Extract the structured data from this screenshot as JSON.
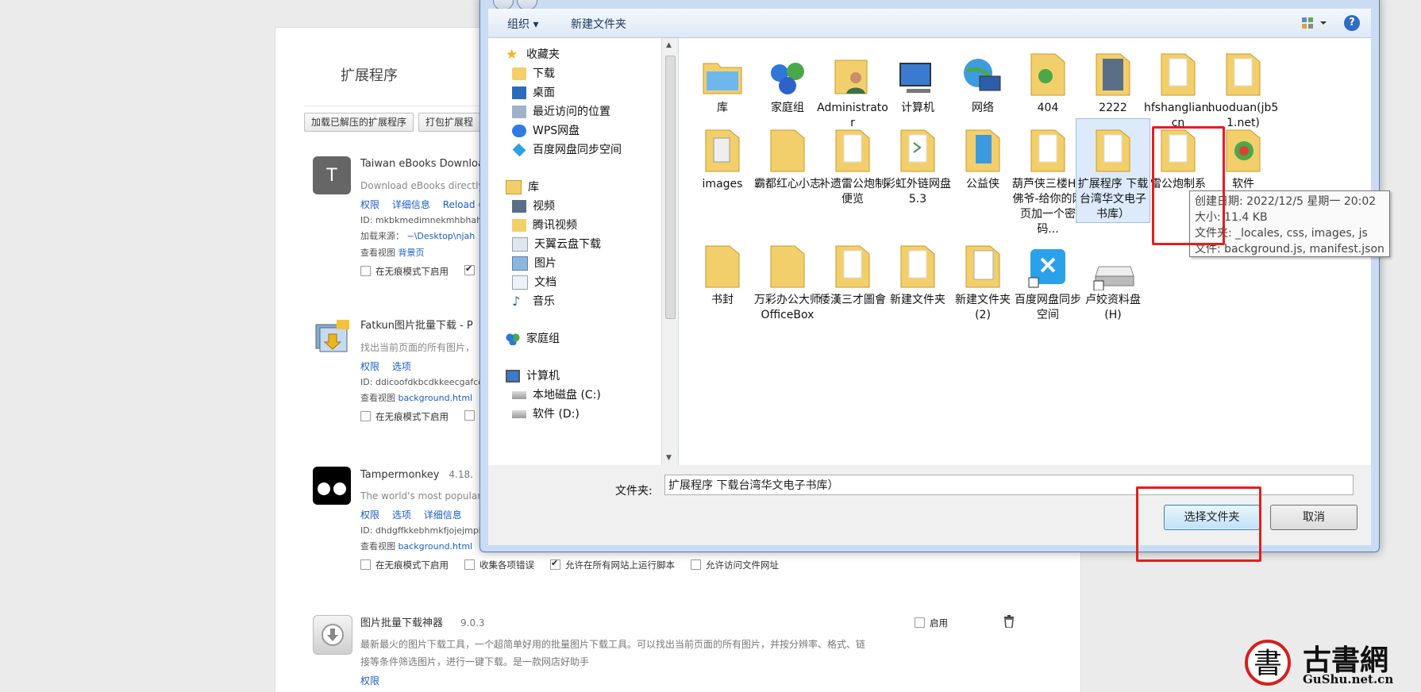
{
  "ext_page": {
    "title": "扩展程序",
    "load_unpacked": "加载已解压的扩展程序",
    "pack": "打包扩展程",
    "extensions": [
      {
        "icon_letter": "T",
        "name": "Taiwan eBooks Downloa",
        "desc": "Download eBooks directly",
        "links": [
          "权限",
          "详细信息",
          "Reload (C"
        ],
        "id": "ID: mkbkmedimnekmhbhahk",
        "source_label": "加载来源：",
        "source_path": "~\\Desktop\\njah",
        "view_label": "查看视图",
        "view_link": "背景页",
        "checks": [
          "在无痕模式下启用"
        ]
      },
      {
        "name": "Fatkun图片批量下载 - P",
        "desc": "找出当前页面的所有图片，",
        "links": [
          "权限",
          "选项"
        ],
        "id": "ID: ddicoofdkbcdkkeecgafco",
        "view_label": "查看视图",
        "view_link": "background.html",
        "checks": [
          "在无痕模式下启用"
        ]
      },
      {
        "name": "Tampermonkey",
        "version": "4.18.",
        "desc": "The world's most popular",
        "links": [
          "权限",
          "选项",
          "详细信息"
        ],
        "id": "ID: dhdgffkkebhmkfjojejmpb",
        "view_label": "查看视图",
        "view_link": "background.html",
        "checks": [
          "在无痕模式下启用",
          "收集各项错误",
          "允许在所有网站上运行脚本",
          "允许访问文件网址"
        ]
      },
      {
        "name": "图片批量下载神器",
        "version": "9.0.3",
        "enable_label": "启用",
        "desc_line1": "最新最火的图片下载工具，一个超简单好用的批量图片下载工具。可以找出当前页面的所有图片，并按分辨率、格式、链",
        "desc_line2": "接等条件筛选图片，进行一键下载。是一款网店好助手",
        "links": [
          "权限"
        ]
      }
    ]
  },
  "dialog": {
    "commands": {
      "organize": "组织 ▾",
      "new_folder": "新建文件夹",
      "help": "?"
    },
    "nav": {
      "favorites": "收藏夹",
      "fav_items": [
        "下载",
        "桌面",
        "最近访问的位置",
        "WPS网盘",
        "百度网盘同步空间"
      ],
      "library": "库",
      "lib_items": [
        "视频",
        "腾讯视频",
        "天翼云盘下载",
        "图片",
        "文档",
        "音乐"
      ],
      "homegroup": "家庭组",
      "computer": "计算机",
      "comp_items": [
        "本地磁盘 (C:)",
        "软件 (D:)"
      ]
    },
    "items": [
      [
        "库",
        "家庭组",
        "Administrator",
        "计算机",
        "网络",
        "404",
        "2222",
        "hfshanglian.cn",
        "huoduan(jb51.net)"
      ],
      [
        "images",
        "霸都红心小志",
        "补遗雷公炮制便览",
        "彩虹外链网盘5.3",
        "公益侠",
        "葫芦侠三楼HR佛爷-给你的网页加一个密码...",
        "扩展程序 下载台湾华文电子书库）",
        "雷公炮制系",
        "软件"
      ],
      [
        "书封",
        "万彩办公大师OfficeBox",
        "倭漢三才圖會",
        "新建文件夹",
        "新建文件夹 (2)",
        "百度网盘同步空间",
        "卢姣资料盘 (H)"
      ]
    ],
    "tooltip": {
      "created": "创建日期: 2022/12/5 星期一 20:02",
      "size": "大小: 11.4 KB",
      "folders": "文件夹: _locales, css, images, js",
      "files": "文件: background.js, manifest.json"
    },
    "folder_label": "文件夹:",
    "folder_value": "扩展程序 下载台湾华文电子书库）",
    "select_button": "选择文件夹",
    "cancel_button": "取消",
    "colors": {
      "highlight": "#e41e1e",
      "selection": "#dceafc",
      "folder": "#f2cf6b"
    }
  },
  "watermark": {
    "char": "書",
    "text": "古書網",
    "url": "GuShu.net.cn"
  }
}
